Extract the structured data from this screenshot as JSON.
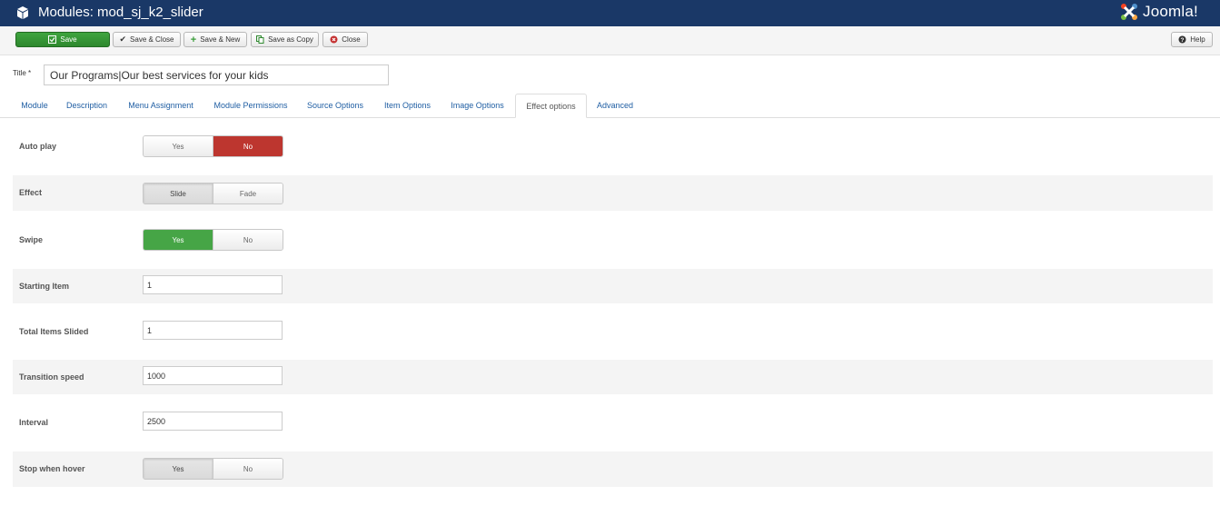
{
  "header": {
    "icon": "cube-icon",
    "title": "Modules: mod_sj_k2_slider",
    "logo_text": "Joomla!"
  },
  "toolbar": {
    "save_label": "Save",
    "save_close_label": "Save & Close",
    "save_new_label": "Save & New",
    "save_copy_label": "Save as Copy",
    "close_label": "Close",
    "help_label": "Help"
  },
  "title_field": {
    "label": "Title *",
    "value": "Our Programs|Our best services for your kids"
  },
  "tabs": [
    {
      "label": "Module"
    },
    {
      "label": "Description"
    },
    {
      "label": "Menu Assignment"
    },
    {
      "label": "Module Permissions"
    },
    {
      "label": "Source Options"
    },
    {
      "label": "Item Options"
    },
    {
      "label": "Image Options"
    },
    {
      "label": "Effect options"
    },
    {
      "label": "Advanced"
    }
  ],
  "active_tab": "Effect options",
  "options": {
    "auto_play": {
      "label": "Auto play",
      "opt1": "Yes",
      "opt2": "No",
      "selected": "No"
    },
    "effect": {
      "label": "Effect",
      "opt1": "Slide",
      "opt2": "Fade",
      "selected": "Slide"
    },
    "swipe": {
      "label": "Swipe",
      "opt1": "Yes",
      "opt2": "No",
      "selected": "Yes"
    },
    "starting_item": {
      "label": "Starting Item",
      "value": "1"
    },
    "total_items_slided": {
      "label": "Total Items Slided",
      "value": "1"
    },
    "transition_speed": {
      "label": "Transition speed",
      "value": "1000"
    },
    "interval": {
      "label": "Interval",
      "value": "2500"
    },
    "stop_when_hover": {
      "label": "Stop when hover",
      "opt1": "Yes",
      "opt2": "No",
      "selected": "Yes"
    }
  },
  "colors": {
    "header_bg": "#1a3867",
    "save_green": "#46a546",
    "no_red": "#bd362f",
    "link_blue": "#1f5ea3"
  }
}
